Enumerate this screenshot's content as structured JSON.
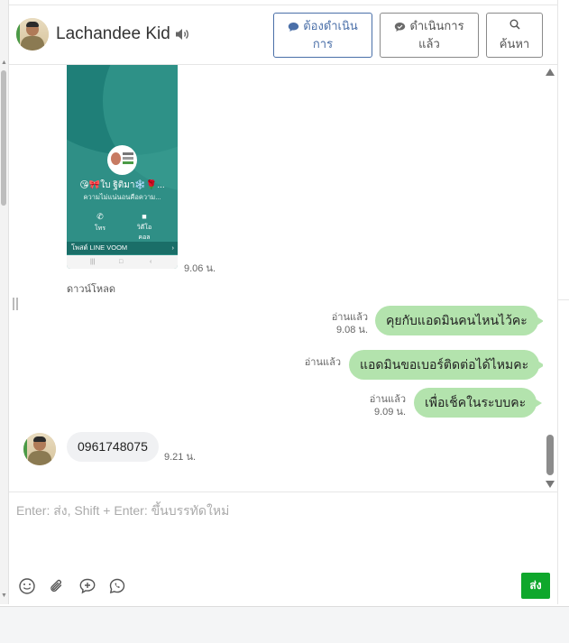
{
  "header": {
    "contact_name": "Lachandee Kid",
    "btn_todo": {
      "line1": "ต้องดำเนิน",
      "line2": "การ"
    },
    "btn_done": {
      "line1": "ดำเนินการ",
      "line2": "แล้ว"
    },
    "btn_search": {
      "label": "ค้นหา"
    },
    "icons": {
      "speaker": "speaker-icon",
      "todo": "chat-bubble-icon",
      "done": "chat-check-icon",
      "search": "search-icon"
    }
  },
  "image_message": {
    "profile_name": "😘🎀ใบ ฐิติมา❄️🌹...",
    "status_text": "ความไม่แน่นอนคือความ...",
    "action_call": "โทร",
    "action_video_1": "วิดีโอ",
    "action_video_2": "คอล",
    "voom_label": "โพสต์ LINE VOOM",
    "time": "9.06 น.",
    "download": "ดาวน์โหลด"
  },
  "messages": [
    {
      "direction": "out",
      "text": "คุยกับแอดมินคนไหนไว้คะ",
      "read": "อ่านแล้ว",
      "time": "9.08 น."
    },
    {
      "direction": "out",
      "text": "แอดมินขอเบอร์ติดต่อได้ไหมคะ",
      "read": "อ่านแล้ว",
      "time": ""
    },
    {
      "direction": "out",
      "text": "เพื่อเช็คในระบบคะ",
      "read": "อ่านแล้ว",
      "time": "9.09 น."
    },
    {
      "direction": "in",
      "text": "0961748075",
      "time": "9.21 น."
    }
  ],
  "composer": {
    "placeholder": "Enter: ส่ง, Shift + Enter: ขึ้นบรรทัดใหม่",
    "send_label": "ส่ง",
    "tools": [
      "emoji-icon",
      "paperclip-icon",
      "sticker-icon",
      "voice-icon"
    ]
  },
  "colors": {
    "outgoing_bubble": "#b3e3ad",
    "incoming_bubble": "#f0f1f3",
    "send_button": "#0fa72c",
    "header_button": "#4a6fa8"
  }
}
